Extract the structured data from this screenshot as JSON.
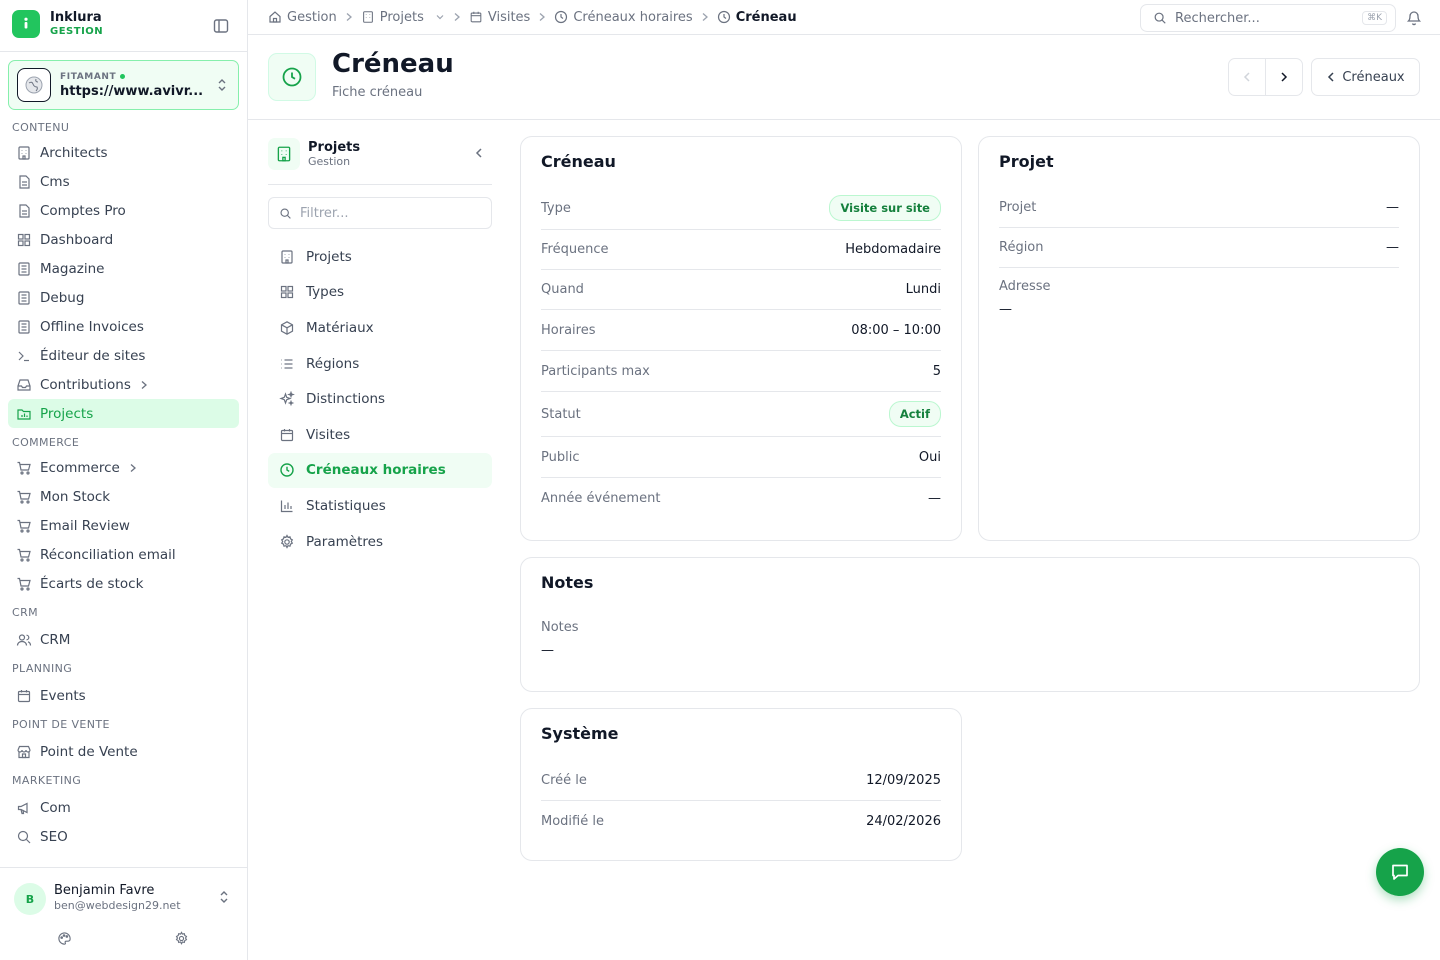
{
  "brand": {
    "name": "Inklura",
    "sub": "GESTION"
  },
  "site": {
    "label": "FITAMANT",
    "url": "https://www.avivr..."
  },
  "nav": {
    "contenu": {
      "title": "CONTENU",
      "items": [
        "Architects",
        "Cms",
        "Comptes Pro",
        "Dashboard",
        "Magazine",
        "Debug",
        "Offline Invoices",
        "Éditeur de sites",
        "Contributions",
        "Projects"
      ]
    },
    "commerce": {
      "title": "COMMERCE",
      "items": [
        "Ecommerce",
        "Mon Stock",
        "Email Review",
        "Réconciliation email",
        "Écarts de stock"
      ]
    },
    "crm": {
      "title": "CRM",
      "items": [
        "CRM"
      ]
    },
    "planning": {
      "title": "PLANNING",
      "items": [
        "Events"
      ]
    },
    "pos": {
      "title": "POINT DE VENTE",
      "items": [
        "Point de Vente"
      ]
    },
    "marketing": {
      "title": "MARKETING",
      "items": [
        "Com",
        "SEO"
      ]
    }
  },
  "user": {
    "initial": "B",
    "name": "Benjamin Favre",
    "email": "ben@webdesign29.net"
  },
  "breadcrumb": [
    "Gestion",
    "Projets",
    "Visites",
    "Créneaux horaires",
    "Créneau"
  ],
  "search": {
    "placeholder": "Rechercher...",
    "shortcut": "⌘K"
  },
  "header": {
    "title": "Créneau",
    "subtitle": "Fiche créneau",
    "back_label": "Créneaux"
  },
  "module": {
    "title": "Projets",
    "subtitle": "Gestion",
    "filter_placeholder": "Filtrer...",
    "items": [
      "Projets",
      "Types",
      "Matériaux",
      "Régions",
      "Distinctions",
      "Visites",
      "Créneaux horaires",
      "Statistiques",
      "Paramètres"
    ]
  },
  "creneau": {
    "title": "Créneau",
    "rows": [
      {
        "label": "Type",
        "value": "Visite sur site"
      },
      {
        "label": "Fréquence",
        "value": "Hebdomadaire"
      },
      {
        "label": "Quand",
        "value": "Lundi"
      },
      {
        "label": "Horaires",
        "value": "08:00 – 10:00"
      },
      {
        "label": "Participants max",
        "value": "5"
      },
      {
        "label": "Statut",
        "value": "Actif"
      },
      {
        "label": "Public",
        "value": "Oui"
      },
      {
        "label": "Année événement",
        "value": "—"
      }
    ]
  },
  "projet": {
    "title": "Projet",
    "rows": [
      {
        "label": "Projet",
        "value": "—"
      },
      {
        "label": "Région",
        "value": "—"
      },
      {
        "label": "Adresse",
        "value": "—"
      }
    ]
  },
  "notes": {
    "title": "Notes",
    "label": "Notes",
    "value": "—"
  },
  "systeme": {
    "title": "Système",
    "rows": [
      {
        "label": "Créé le",
        "value": "12/09/2025"
      },
      {
        "label": "Modifié le",
        "value": "24/02/2026"
      }
    ]
  },
  "colors": {
    "accent": "#16a34a",
    "accent_light": "#dcfce7",
    "border": "#e5e7eb"
  }
}
